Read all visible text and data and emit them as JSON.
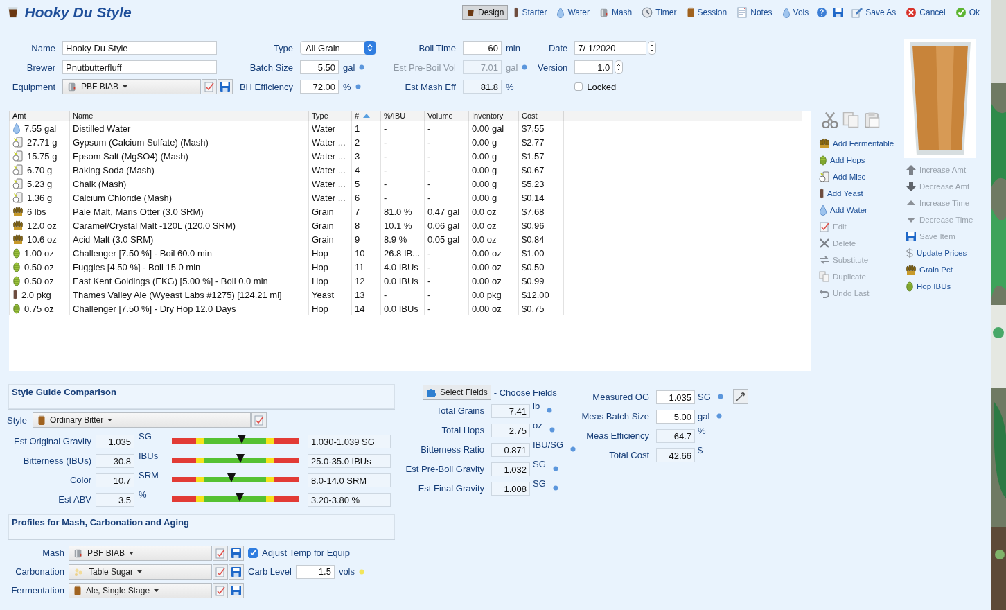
{
  "window": {
    "title": "Hooky Du Style"
  },
  "toolbar": {
    "views": [
      {
        "label": "Design",
        "selected": true
      },
      {
        "label": "Starter",
        "selected": false
      },
      {
        "label": "Water",
        "selected": false
      },
      {
        "label": "Mash",
        "selected": false
      },
      {
        "label": "Timer",
        "selected": false
      },
      {
        "label": "Session",
        "selected": false
      },
      {
        "label": "Notes",
        "selected": false
      },
      {
        "label": "Vols",
        "selected": false
      }
    ],
    "actions": [
      "Save As",
      "Cancel",
      "Ok"
    ]
  },
  "form": {
    "name": {
      "label": "Name",
      "value": "Hooky Du Style"
    },
    "brewer": {
      "label": "Brewer",
      "value": "Pnutbutterfluff"
    },
    "equipment": {
      "label": "Equipment",
      "value": "PBF BIAB"
    },
    "type": {
      "label": "Type",
      "value": "All Grain"
    },
    "batch_size": {
      "label": "Batch Size",
      "value": "5.50",
      "unit": "gal",
      "readonly": false
    },
    "bh_efficiency": {
      "label": "BH Efficiency",
      "value": "72.00",
      "unit": "%",
      "readonly": false
    },
    "boil_time": {
      "label": "Boil Time",
      "value": "60",
      "unit": "min",
      "readonly": false
    },
    "pre_boil_vol": {
      "label": "Est Pre-Boil Vol",
      "value": "7.01",
      "unit": "gal",
      "disabled": true
    },
    "mash_eff": {
      "label": "Est Mash Eff",
      "value": "81.8",
      "unit": "%",
      "readonly": true
    },
    "date": {
      "label": "Date",
      "value": "7/  1/2020"
    },
    "version": {
      "label": "Version",
      "value": "1.0"
    },
    "locked": {
      "label": "Locked",
      "checked": false
    }
  },
  "table": {
    "columns": [
      "Amt",
      "Name",
      "Type",
      "#",
      "%/IBU",
      "Volume",
      "Inventory",
      "Cost"
    ],
    "rows": [
      {
        "kind": "water",
        "cells": [
          "7.55 gal",
          "Distilled Water",
          "Water",
          "1",
          "-",
          "-",
          "0.00 gal",
          "$7.55"
        ]
      },
      {
        "kind": "misc",
        "cells": [
          "27.71 g",
          "Gypsum (Calcium Sulfate) (Mash)",
          "Water ...",
          "2",
          "-",
          "-",
          "0.00 g",
          "$2.77"
        ]
      },
      {
        "kind": "misc",
        "cells": [
          "15.75 g",
          "Epsom Salt (MgSO4) (Mash)",
          "Water ...",
          "3",
          "-",
          "-",
          "0.00 g",
          "$1.57"
        ]
      },
      {
        "kind": "misc",
        "cells": [
          "6.70 g",
          "Baking Soda (Mash)",
          "Water ...",
          "4",
          "-",
          "-",
          "0.00 g",
          "$0.67"
        ]
      },
      {
        "kind": "misc",
        "cells": [
          "5.23 g",
          "Chalk (Mash)",
          "Water ...",
          "5",
          "-",
          "-",
          "0.00 g",
          "$5.23"
        ]
      },
      {
        "kind": "misc",
        "cells": [
          "1.36 g",
          "Calcium Chloride (Mash)",
          "Water ...",
          "6",
          "-",
          "-",
          "0.00 g",
          "$0.14"
        ]
      },
      {
        "kind": "grain",
        "cells": [
          "6 lbs",
          "Pale Malt, Maris Otter (3.0 SRM)",
          "Grain",
          "7",
          "81.0 %",
          "0.47 gal",
          "0.0 oz",
          "$7.68"
        ]
      },
      {
        "kind": "grain",
        "cells": [
          "12.0 oz",
          "Caramel/Crystal Malt -120L (120.0 SRM)",
          "Grain",
          "8",
          "10.1 %",
          "0.06 gal",
          "0.0 oz",
          "$0.96"
        ]
      },
      {
        "kind": "grain",
        "cells": [
          "10.6 oz",
          "Acid Malt (3.0 SRM)",
          "Grain",
          "9",
          "8.9 %",
          "0.05 gal",
          "0.0 oz",
          "$0.84"
        ]
      },
      {
        "kind": "hop",
        "cells": [
          "1.00 oz",
          "Challenger [7.50 %] - Boil 60.0 min",
          "Hop",
          "10",
          "26.8 IB...",
          "-",
          "0.00 oz",
          "$1.00"
        ]
      },
      {
        "kind": "hop",
        "cells": [
          "0.50 oz",
          "Fuggles [4.50 %] - Boil 15.0 min",
          "Hop",
          "11",
          "4.0 IBUs",
          "-",
          "0.00 oz",
          "$0.50"
        ]
      },
      {
        "kind": "hop",
        "cells": [
          "0.50 oz",
          "East Kent Goldings (EKG) [5.00 %] - Boil 0.0 min",
          "Hop",
          "12",
          "0.0 IBUs",
          "-",
          "0.00 oz",
          "$0.99"
        ]
      },
      {
        "kind": "yeast",
        "cells": [
          "2.0 pkg",
          "Thames Valley Ale (Wyeast Labs #1275) [124.21 ml]",
          "Yeast",
          "13",
          "-",
          "-",
          "0.0 pkg",
          "$12.00"
        ]
      },
      {
        "kind": "hop",
        "cells": [
          "0.75 oz",
          "Challenger [7.50 %] - Dry Hop 12.0 Days",
          "Hop",
          "14",
          "0.0 IBUs",
          "-",
          "0.00 oz",
          "$0.75"
        ]
      }
    ]
  },
  "ingredient_actions": [
    {
      "label": "Add Fermentable",
      "disabled": false
    },
    {
      "label": "Add Hops",
      "disabled": false
    },
    {
      "label": "Add Misc",
      "disabled": false
    },
    {
      "label": "Add Yeast",
      "disabled": false
    },
    {
      "label": "Add Water",
      "disabled": false
    },
    {
      "label": "Edit",
      "disabled": true
    },
    {
      "label": "Delete",
      "disabled": true
    },
    {
      "label": "Substitute",
      "disabled": true
    },
    {
      "label": "Duplicate",
      "disabled": true
    },
    {
      "label": "Undo Last",
      "disabled": true
    }
  ],
  "adjust_actions": [
    {
      "label": "Increase Amt",
      "disabled": true
    },
    {
      "label": "Decrease Amt",
      "disabled": true
    },
    {
      "label": "Increase Time",
      "disabled": true
    },
    {
      "label": "Decrease Time",
      "disabled": true
    },
    {
      "label": "Save Item",
      "disabled": true
    },
    {
      "label": "Update Prices",
      "disabled": false
    },
    {
      "label": "Grain Pct",
      "disabled": false
    },
    {
      "label": "Hop IBUs",
      "disabled": false
    }
  ],
  "style_guide": {
    "title": "Style Guide Comparison",
    "style_label": "Style",
    "style": "Ordinary Bitter",
    "rows": [
      {
        "label": "Est Original Gravity",
        "value": "1.035",
        "unit": "SG",
        "level": 0.55,
        "range": "1.030-1.039 SG"
      },
      {
        "label": "Bitterness (IBUs)",
        "value": "30.8",
        "unit": "IBUs",
        "level": 0.54,
        "range": "25.0-35.0 IBUs"
      },
      {
        "label": "Color",
        "value": "10.7",
        "unit": "SRM",
        "level": 0.47,
        "range": "8.0-14.0 SRM"
      },
      {
        "label": "Est ABV",
        "value": "3.5",
        "unit": "%",
        "level": 0.53,
        "range": "3.20-3.80 %"
      }
    ]
  },
  "profiles": {
    "title": "Profiles for Mash, Carbonation and Aging",
    "mash": {
      "label": "Mash",
      "value": "PBF BIAB"
    },
    "adjust_temp": {
      "label": "Adjust Temp for Equip",
      "checked": true
    },
    "carbonation": {
      "label": "Carbonation",
      "value": "Table Sugar"
    },
    "carb_level": {
      "label": "Carb Level",
      "value": "1.5",
      "unit": "vols"
    },
    "fermentation": {
      "label": "Fermentation",
      "value": "Ale, Single Stage"
    }
  },
  "stats": {
    "select_button": "Select Fields",
    "choose": "- Choose Fields",
    "rows": [
      {
        "label": "Total Grains",
        "value": "7.41",
        "unit": "lb"
      },
      {
        "label": "Total Hops",
        "value": "2.75",
        "unit": "oz"
      },
      {
        "label": "Bitterness Ratio",
        "value": "0.871",
        "unit": "IBU/SG"
      },
      {
        "label": "Est Pre-Boil Gravity",
        "value": "1.032",
        "unit": "SG"
      },
      {
        "label": "Est Final Gravity",
        "value": "1.008",
        "unit": "SG"
      }
    ]
  },
  "measured": [
    {
      "label": "Measured OG",
      "value": "1.035",
      "unit": "SG",
      "readonly": false
    },
    {
      "label": "Meas Batch Size",
      "value": "5.00",
      "unit": "gal",
      "readonly": false
    },
    {
      "label": "Meas Efficiency",
      "value": "64.7",
      "unit": "%",
      "readonly": true
    },
    {
      "label": "Total Cost",
      "value": "42.66",
      "unit": "$",
      "readonly": true
    }
  ]
}
